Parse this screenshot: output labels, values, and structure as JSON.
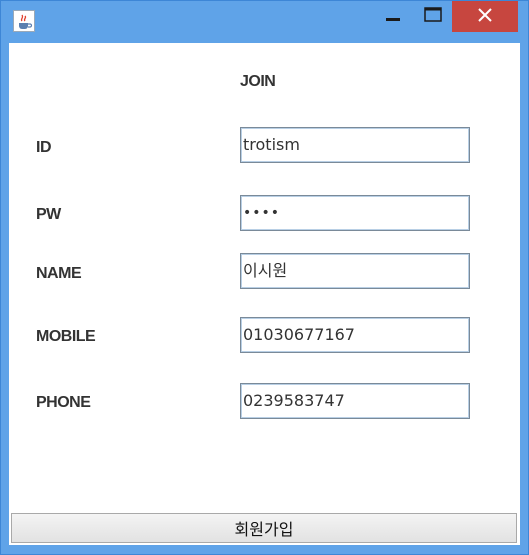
{
  "window": {
    "icon": "java-cup-icon",
    "controls": [
      "minimize-icon",
      "maximize-icon",
      "close-icon"
    ]
  },
  "form": {
    "title": "JOIN",
    "id_label": "ID",
    "id_value": "trotism",
    "pw_label": "PW",
    "pw_value": "••••",
    "name_label": "NAME",
    "name_value": "이시원",
    "mobile_label": "MOBILE",
    "mobile_value": "01030677167",
    "phone_label": "PHONE",
    "phone_value": "0239583747",
    "submit_label": "회원가입"
  },
  "colors": {
    "titlebar": "#5fa3e8",
    "close_button": "#c7463f",
    "background": "#ffffff"
  }
}
